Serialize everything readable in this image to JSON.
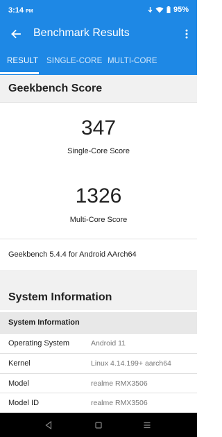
{
  "status_bar": {
    "time": "3:14",
    "ampm": "PM",
    "battery": "95%"
  },
  "app_bar": {
    "title": "Benchmark Results",
    "back_icon": "arrow-left-icon",
    "more_icon": "more-vertical-icon"
  },
  "tabs": [
    {
      "label": "RESULT",
      "active": true
    },
    {
      "label": "SINGLE-CORE",
      "active": false
    },
    {
      "label": "MULTI-CORE",
      "active": false
    }
  ],
  "geekbench": {
    "header": "Geekbench Score",
    "single_core_score": "347",
    "single_core_label": "Single-Core Score",
    "multi_core_score": "1326",
    "multi_core_label": "Multi-Core Score",
    "version": "Geekbench 5.4.4 for Android AArch64"
  },
  "system_info": {
    "header": "System Information",
    "subheader": "System Information",
    "rows": [
      {
        "key": "Operating System",
        "value": "Android 11"
      },
      {
        "key": "Kernel",
        "value": "Linux 4.14.199+ aarch64"
      },
      {
        "key": "Model",
        "value": "realme RMX3506"
      },
      {
        "key": "Model ID",
        "value": "realme RMX3506"
      }
    ]
  },
  "colors": {
    "primary": "#1e88e5",
    "section_bg": "#f1f1f1",
    "nav_bar": "#000000"
  }
}
